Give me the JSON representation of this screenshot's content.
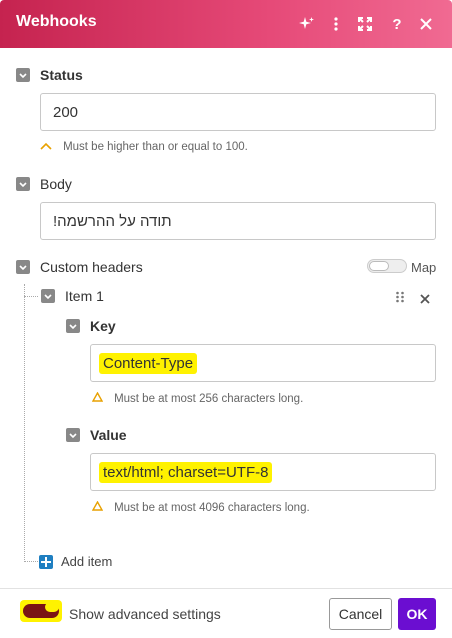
{
  "header": {
    "title": "Webhooks",
    "icons": [
      "sparkle-icon",
      "more-vertical-icon",
      "expand-icon",
      "help-icon",
      "close-icon"
    ],
    "help_glyph": "?"
  },
  "status": {
    "label": "Status",
    "value": "200",
    "hint": "Must be higher than or equal to 100."
  },
  "body_field": {
    "label": "Body",
    "value": "תודה על ההרשמה!"
  },
  "custom_headers": {
    "label": "Custom headers",
    "map_label": "Map",
    "item": {
      "label": "Item 1",
      "key": {
        "label": "Key",
        "value": "Content-Type",
        "hint": "Must be at most 256 characters long."
      },
      "value": {
        "label": "Value",
        "value": "text/html; charset=UTF-8",
        "hint": "Must be at most 4096 characters long."
      }
    },
    "add_item_label": "Add item"
  },
  "footer": {
    "advanced_label": "Show advanced settings",
    "cancel_label": "Cancel",
    "ok_label": "OK"
  },
  "colors": {
    "header_start": "#c5234f",
    "header_end": "#f06a92",
    "ok_button": "#6b0ed1",
    "highlight": "#fff200",
    "add_item_icon": "#1f7fc1"
  }
}
